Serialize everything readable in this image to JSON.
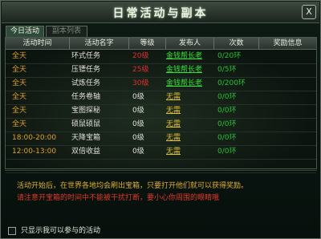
{
  "window": {
    "title": "日常活动与副本",
    "close_label": "X"
  },
  "tabs": [
    {
      "label": "今日活动",
      "active": true
    },
    {
      "label": "副本列表",
      "active": false
    }
  ],
  "table": {
    "headers": [
      "活动时间",
      "活动名字",
      "等级",
      "发布人",
      "次数",
      "奖励信息"
    ],
    "rows": [
      {
        "time": "全天",
        "name": "环式任务",
        "level": "20级",
        "publisher": "金钱帮长老",
        "count": "0/20环"
      },
      {
        "time": "全天",
        "name": "压镖任务",
        "level": "25级",
        "publisher": "金钱帮长老",
        "count": "0/5环"
      },
      {
        "time": "全天",
        "name": "试炼任务",
        "level": "30级",
        "publisher": "金钱帮长老",
        "count": "0/200环"
      },
      {
        "time": "全天",
        "name": "任务卷轴",
        "level": "0级",
        "publisher": "无需",
        "count": "0/0环"
      },
      {
        "time": "全天",
        "name": "宝图探秘",
        "level": "0级",
        "publisher": "无需",
        "count": "0/0环"
      },
      {
        "time": "全天",
        "name": "硕鼠硕鼠",
        "level": "0级",
        "publisher": "无需",
        "count": "0/0环"
      },
      {
        "time": "18:00-20:00",
        "name": "天降宝箱",
        "level": "0级",
        "publisher": "无需",
        "count": "0/0环"
      },
      {
        "time": "12:00-13:00",
        "name": "双倍收益",
        "level": "0级",
        "publisher": "无需",
        "count": "0/0环"
      },
      {
        "time": "",
        "name": "",
        "level": "",
        "publisher": "",
        "count": ""
      }
    ]
  },
  "description": {
    "line1": "活动开始后，在世界各地均会刷出宝箱，只要打开他们就可以获得奖励。",
    "line2": "请注意开宝箱的时间中不能被干扰打断，要小心你周围的眼睛哦"
  },
  "footer": {
    "checkbox_label": "只显示我可以参与的活动",
    "checked": false
  },
  "colors": {
    "time": "#e0a028",
    "name": "#e2e2d6",
    "level_high": "#e03030",
    "level_zero": "#e2e2d6",
    "publisher_npc": "#38e038",
    "publisher_none": "#e0c030",
    "count": "#28c236",
    "desc_line1": "#e0b030",
    "desc_line2": "#e03a2a"
  }
}
